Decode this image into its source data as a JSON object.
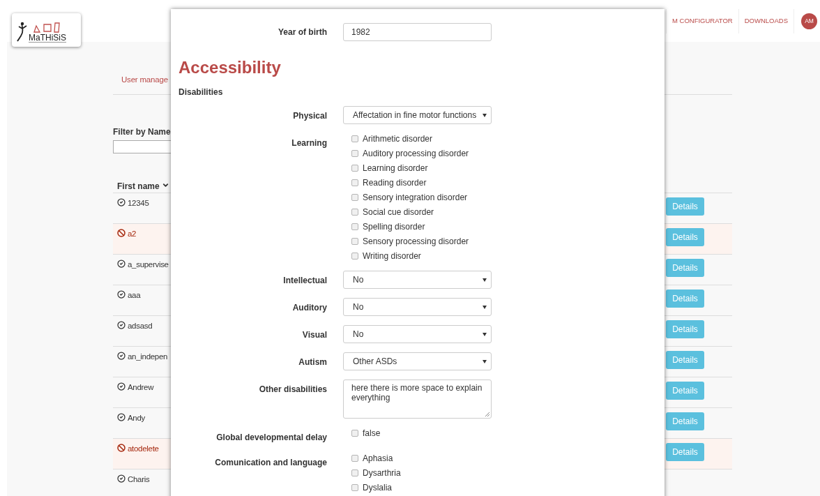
{
  "header": {
    "logo_text": "MaTHiSiS",
    "nav": [
      "M CONFIGURATOR",
      "DOWNLOADS"
    ],
    "avatar": "AM"
  },
  "background": {
    "tab": "User manage",
    "filter_label": "Filter by Name",
    "column": "First name",
    "rows": [
      {
        "name": "12345",
        "kind": "active",
        "button": "Details"
      },
      {
        "name": "a2",
        "kind": "blocked",
        "button": "Details"
      },
      {
        "name": "a_supervise",
        "kind": "active",
        "button": "Details"
      },
      {
        "name": "aaa",
        "kind": "active",
        "button": "Details"
      },
      {
        "name": "adsasd",
        "kind": "active",
        "button": "Details"
      },
      {
        "name": "an_indepen",
        "kind": "active",
        "button": "Details"
      },
      {
        "name": "Andrew",
        "kind": "active",
        "button": "Details"
      },
      {
        "name": "Andy",
        "kind": "active",
        "button": "Details"
      },
      {
        "name": "atodelete",
        "kind": "blocked",
        "button": "Details"
      },
      {
        "name": "Charis",
        "kind": "active"
      }
    ]
  },
  "modal": {
    "top_field": {
      "label": "Year of birth",
      "value": "1982"
    },
    "heading": "Accessibility",
    "section": "Disabilities",
    "fields": [
      {
        "kind": "select",
        "label": "Physical",
        "value": "Affectation in fine motor functions"
      },
      {
        "kind": "checklist",
        "label": "Learning",
        "options": [
          {
            "label": "Arithmetic disorder",
            "checked": false
          },
          {
            "label": "Auditory processing disorder",
            "checked": false
          },
          {
            "label": "Learning disorder",
            "checked": false
          },
          {
            "label": "Reading disorder",
            "checked": false
          },
          {
            "label": "Sensory integration disorder",
            "checked": false
          },
          {
            "label": "Social cue disorder",
            "checked": false
          },
          {
            "label": "Spelling disorder",
            "checked": false
          },
          {
            "label": "Sensory processing disorder",
            "checked": false
          },
          {
            "label": "Writing disorder",
            "checked": false
          }
        ]
      },
      {
        "kind": "select",
        "label": "Intellectual",
        "value": "No"
      },
      {
        "kind": "select",
        "label": "Auditory",
        "value": "No"
      },
      {
        "kind": "select",
        "label": "Visual",
        "value": "No"
      },
      {
        "kind": "select",
        "label": "Autism",
        "value": "Other ASDs"
      },
      {
        "kind": "textarea",
        "label": "Other disabilities",
        "value": "here there is more space to explain everything"
      },
      {
        "kind": "checklist",
        "label": "Global developmental delay",
        "options": [
          {
            "label": "false",
            "checked": false
          }
        ]
      },
      {
        "kind": "checklist",
        "label": "Comunication and language",
        "options": [
          {
            "label": "Aphasia",
            "checked": false
          },
          {
            "label": "Dysarthria",
            "checked": false
          },
          {
            "label": "Dyslalia",
            "checked": false
          }
        ]
      }
    ]
  }
}
